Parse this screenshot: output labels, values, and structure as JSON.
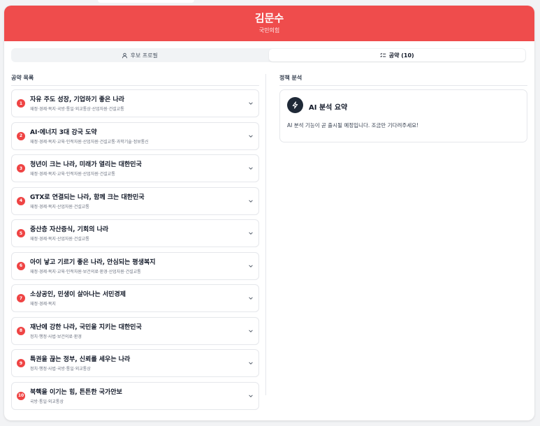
{
  "candidate": {
    "name": "김문수",
    "party": "국민의힘"
  },
  "colors": {
    "header": "#ef4c4c",
    "badge": "#ef4444"
  },
  "tabs": [
    {
      "label": "후보 프로필",
      "icon": "user-icon",
      "active": false
    },
    {
      "label": "공약 (10)",
      "icon": "list-check-icon",
      "active": true
    }
  ],
  "pledges": {
    "section_title": "공약 목록",
    "items": [
      {
        "num": "1",
        "title": "자유 주도 성장, 기업하기 좋은 나라",
        "categories": "재정·경제·복지·국방·통일·외교통상·산업자원·건설교통"
      },
      {
        "num": "2",
        "title": "AI·에너지 3대 강국 도약",
        "categories": "재정·경제·복지·교육·인적자원·산업자원·건설교통·과학기술·정보통신"
      },
      {
        "num": "3",
        "title": "청년이 크는 나라, 미래가 열리는 대한민국",
        "categories": "재정·경제·복지·교육·인적자원·산업자원·건설교통"
      },
      {
        "num": "4",
        "title": "GTX로 연결되는 나라, 함께 크는 대한민국",
        "categories": "재정·경제·복지·산업자원·건설교통"
      },
      {
        "num": "5",
        "title": "중산층 자산증식, 기회의 나라",
        "categories": "재정·경제·복지·산업자원·건설교통"
      },
      {
        "num": "6",
        "title": "아이 낳고 기르기 좋은 나라, 안심되는 평생복지",
        "categories": "재정·경제·복지·교육·인적자원·보건의료·환경·산업자원·건설교통"
      },
      {
        "num": "7",
        "title": "소상공인, 민생이 살아나는 서민경제",
        "categories": "재정·경제·복지"
      },
      {
        "num": "8",
        "title": "재난에 강한 나라, 국민을 지키는 대한민국",
        "categories": "정치·행정·사법·보건의료·환경"
      },
      {
        "num": "9",
        "title": "특권을 끊는 정부, 신뢰를 세우는 나라",
        "categories": "정치·행정·사법·국방·통일·외교통상"
      },
      {
        "num": "10",
        "title": "북핵을 이기는 힘, 튼튼한 국가안보",
        "categories": "국방·통일·외교통상"
      }
    ]
  },
  "analysis": {
    "section_title": "정책 분석",
    "ai_title": "AI 분석 요약",
    "ai_icon": "lightning-icon",
    "ai_message": "AI 분석 기능이 곧 출시될 예정입니다. 조금만 기다려주세요!"
  }
}
